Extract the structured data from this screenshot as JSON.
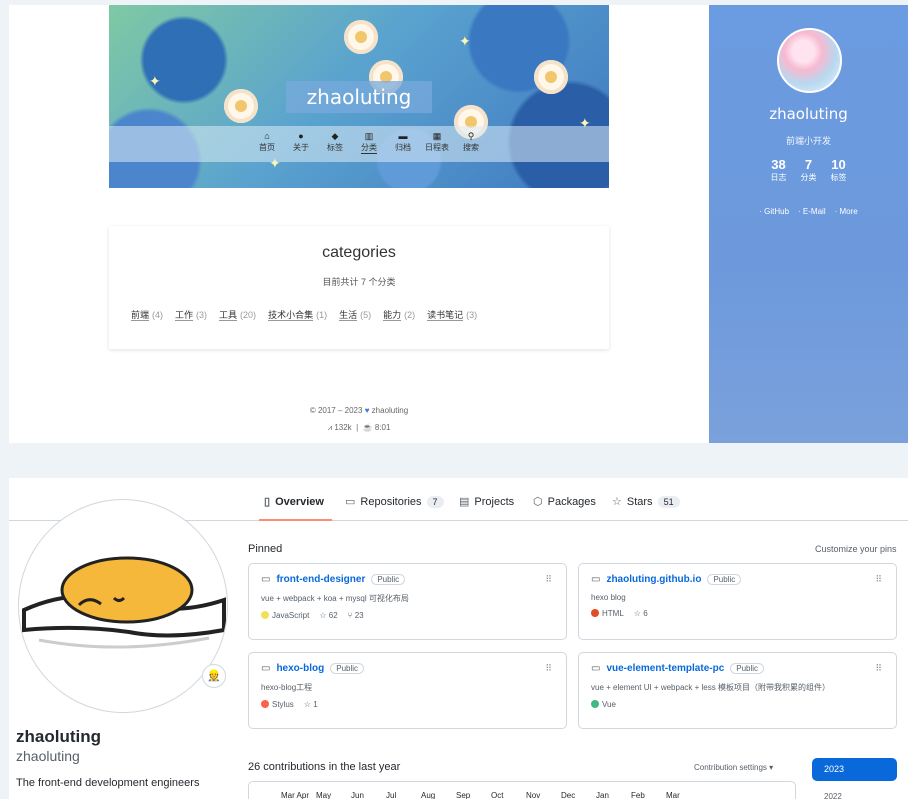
{
  "blog": {
    "title": "zhaoluting",
    "nav": [
      {
        "icon": "home-icon",
        "glyph": "⌂",
        "label": "首页"
      },
      {
        "icon": "user-icon",
        "glyph": "●",
        "label": "关于"
      },
      {
        "icon": "tag-icon",
        "glyph": "◆",
        "label": "标签"
      },
      {
        "icon": "grid-icon",
        "glyph": "▥",
        "label": "分类"
      },
      {
        "icon": "archive-icon",
        "glyph": "▬",
        "label": "归档"
      },
      {
        "icon": "calendar-icon",
        "glyph": "▦",
        "label": "日程表"
      },
      {
        "icon": "search-icon",
        "glyph": "⚲",
        "label": "搜索"
      }
    ],
    "categories": {
      "title": "categories",
      "count_text": "目前共计 7 个分类",
      "items": [
        {
          "name": "前端",
          "count": "(4)"
        },
        {
          "name": "工作",
          "count": "(3)"
        },
        {
          "name": "工具",
          "count": "(20)"
        },
        {
          "name": "技术小合集",
          "count": "(1)"
        },
        {
          "name": "生活",
          "count": "(5)"
        },
        {
          "name": "能力",
          "count": "(2)"
        },
        {
          "name": "读书笔记",
          "count": "(3)"
        }
      ]
    },
    "footer": {
      "copyright": "© 2017 – 2023",
      "author": "zhaoluting",
      "words": "132k",
      "time": "8:01"
    },
    "sidebar": {
      "name": "zhaoluting",
      "subtitle": "前端小开发",
      "stats": [
        {
          "num": "38",
          "label": "日志"
        },
        {
          "num": "7",
          "label": "分类"
        },
        {
          "num": "10",
          "label": "标签"
        }
      ],
      "links": [
        "· GitHub",
        "· E-Mail",
        "· More"
      ]
    }
  },
  "github": {
    "tabs": [
      {
        "icon": "book-icon",
        "label": "Overview",
        "count": ""
      },
      {
        "icon": "repo-icon",
        "label": "Repositories",
        "count": "7"
      },
      {
        "icon": "project-icon",
        "label": "Projects",
        "count": ""
      },
      {
        "icon": "package-icon",
        "label": "Packages",
        "count": ""
      },
      {
        "icon": "star-icon",
        "label": "Stars",
        "count": "51"
      }
    ],
    "profile": {
      "name": "zhaoluting",
      "login": "zhaoluting",
      "bio": "The front-end development engineers",
      "status_emoji": "👷"
    },
    "pinned_label": "Pinned",
    "customize_label": "Customize your pins",
    "repos": [
      {
        "name": "front-end-designer",
        "visibility": "Public",
        "desc": "vue + webpack + koa + mysql 可视化布局",
        "lang": "JavaScript",
        "lang_color": "#f1e05a",
        "stars": "62",
        "forks": "23"
      },
      {
        "name": "zhaoluting.github.io",
        "visibility": "Public",
        "desc": "hexo blog",
        "lang": "HTML",
        "lang_color": "#e34c26",
        "stars": "6",
        "forks": ""
      },
      {
        "name": "hexo-blog",
        "visibility": "Public",
        "desc": "hexo-blog工程",
        "lang": "Stylus",
        "lang_color": "#ff6347",
        "stars": "1",
        "forks": ""
      },
      {
        "name": "vue-element-template-pc",
        "visibility": "Public",
        "desc": "vue + element UI + webpack + less 模板项目（附带我积累的组件）",
        "lang": "Vue",
        "lang_color": "#41b883",
        "stars": "",
        "forks": ""
      }
    ],
    "contrib_label": "26 contributions in the last year",
    "contrib_settings": "Contribution settings ▾",
    "year": "2023",
    "year_next": "2022",
    "months": [
      "Mar Apr",
      "May",
      "Jun",
      "Jul",
      "Aug",
      "Sep",
      "Oct",
      "Nov",
      "Dec",
      "Jan",
      "Feb",
      "Mar"
    ]
  }
}
